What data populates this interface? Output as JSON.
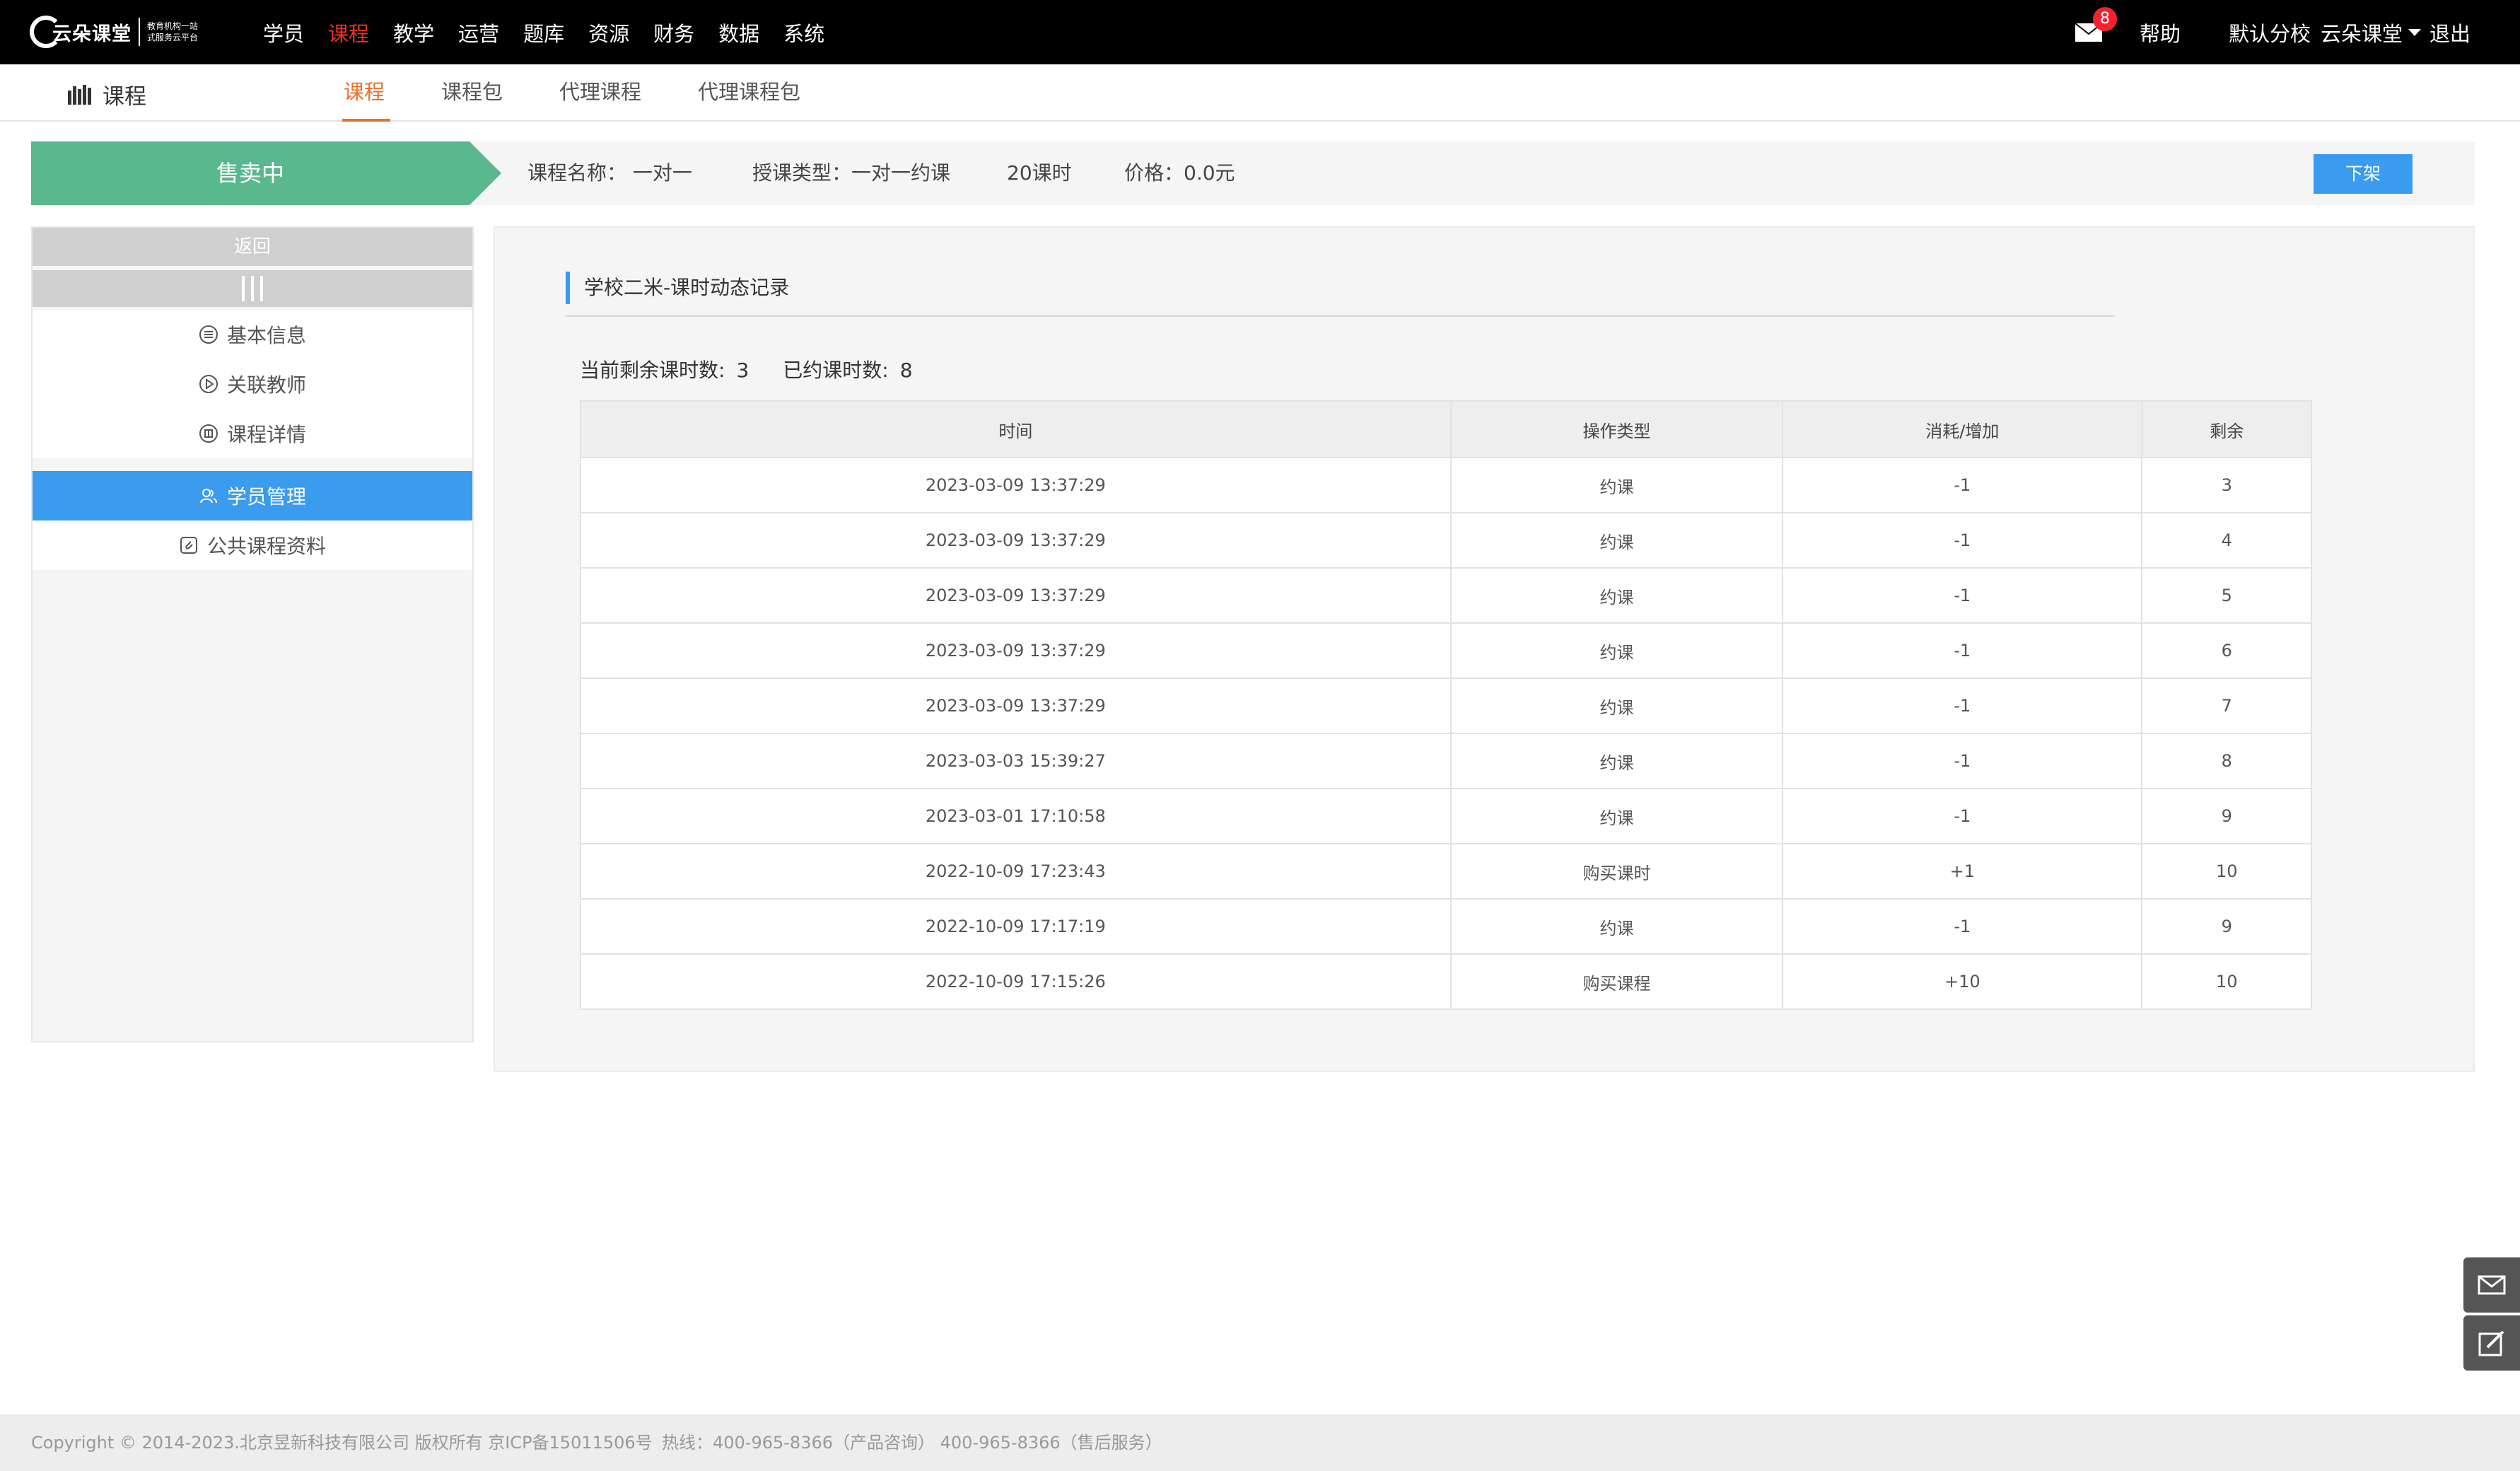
{
  "logo": {
    "name": "云朵课堂",
    "slogan_line1": "教育机构一站",
    "slogan_line2": "式服务云平台"
  },
  "topnav": [
    "学员",
    "课程",
    "教学",
    "运营",
    "题库",
    "资源",
    "财务",
    "数据",
    "系统"
  ],
  "header": {
    "mail_count": "8",
    "help": "帮助",
    "school": "默认分校",
    "user": "云朵课堂",
    "logout": "退出"
  },
  "section": {
    "title": "课程"
  },
  "subtabs": [
    "课程",
    "课程包",
    "代理课程",
    "代理课程包"
  ],
  "status": {
    "state": "售卖中",
    "course_name": "课程名称： 一对一",
    "teach_type": "授课类型：一对一约课",
    "hours": "20课时",
    "price": "价格：0.0元",
    "offshelf": "下架"
  },
  "sidebar": {
    "back": "返回",
    "items": [
      "基本信息",
      "关联教师",
      "课程详情"
    ],
    "items2": [
      "学员管理",
      "公共课程资料"
    ]
  },
  "panel": {
    "title": "学校二米-课时动态记录",
    "remain_label": "当前剩余课时数:",
    "remain_value": "3",
    "booked_label": "已约课时数:",
    "booked_value": "8"
  },
  "table": {
    "headers": [
      "时间",
      "操作类型",
      "消耗/增加",
      "剩余"
    ],
    "rows": [
      [
        "2023-03-09 13:37:29",
        "约课",
        "-1",
        "3"
      ],
      [
        "2023-03-09 13:37:29",
        "约课",
        "-1",
        "4"
      ],
      [
        "2023-03-09 13:37:29",
        "约课",
        "-1",
        "5"
      ],
      [
        "2023-03-09 13:37:29",
        "约课",
        "-1",
        "6"
      ],
      [
        "2023-03-09 13:37:29",
        "约课",
        "-1",
        "7"
      ],
      [
        "2023-03-03 15:39:27",
        "约课",
        "-1",
        "8"
      ],
      [
        "2023-03-01 17:10:58",
        "约课",
        "-1",
        "9"
      ],
      [
        "2022-10-09 17:23:43",
        "购买课时",
        "+1",
        "10"
      ],
      [
        "2022-10-09 17:17:19",
        "约课",
        "-1",
        "9"
      ],
      [
        "2022-10-09 17:15:26",
        "购买课程",
        "+10",
        "10"
      ]
    ]
  },
  "footer": {
    "copyright": "Copyright © 2014-2023.北京昱新科技有限公司 版权所有 京ICP备15011506号",
    "hotline": "热线：400-965-8366（产品咨询） 400-965-8366（售后服务）"
  },
  "colors": {
    "accent": "#3a9bef",
    "selling": "#5ab88e",
    "active_nav": "#e8341e",
    "active_tab": "#e8712a"
  }
}
